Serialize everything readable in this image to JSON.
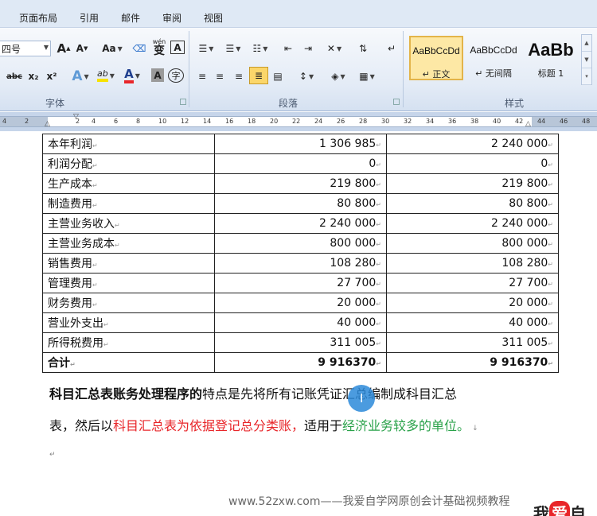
{
  "ribbon_tabs": [
    "页面布局",
    "引用",
    "邮件",
    "审阅",
    "视图"
  ],
  "font": {
    "size_value": "四号",
    "grow_label": "A",
    "shrink_label": "A",
    "case_label": "Aa",
    "phonetic_label": "wén",
    "border_char_label": "A",
    "strike_label": "abc",
    "sub_label": "x₂",
    "sup_label": "x²",
    "effect_label": "A",
    "highlight_label": "ab",
    "fontcolor_label": "A",
    "shading_label": "A",
    "enclose_label": "字",
    "group_label": "字体"
  },
  "paragraph": {
    "group_label": "段落"
  },
  "styles": {
    "group_label": "样式",
    "items": [
      {
        "preview": "AaBbCcDd",
        "name": "↵ 正文"
      },
      {
        "preview": "AaBbCcDd",
        "name": "↵ 无间隔"
      },
      {
        "preview": "AaBb",
        "name": "标题 1"
      }
    ]
  },
  "ruler": {
    "numbers": [
      "4",
      "2",
      "2",
      "4",
      "6",
      "8",
      "10",
      "12",
      "14",
      "16",
      "18",
      "20",
      "22",
      "24",
      "26",
      "28",
      "30",
      "32",
      "34",
      "36",
      "38",
      "40",
      "42",
      "44",
      "46",
      "48"
    ]
  },
  "table": {
    "rows": [
      [
        "本年利润",
        "1  306  985",
        "2  240  000"
      ],
      [
        "利润分配",
        "0",
        "0"
      ],
      [
        "生产成本",
        "219 800",
        "219  800"
      ],
      [
        "制造费用",
        "80 800",
        "80  800"
      ],
      [
        "主营业务收入",
        "2 240 000",
        "2  240  000"
      ],
      [
        "主营业务成本",
        "800 000",
        "800  000"
      ],
      [
        "销售费用",
        "108 280",
        "108  280"
      ],
      [
        "管理费用",
        "27 700",
        "27 700"
      ],
      [
        "财务费用",
        "20 000",
        "20  000"
      ],
      [
        "营业外支出",
        "40 000",
        "40  000"
      ],
      [
        "所得税费用",
        "311 005",
        "311  005"
      ]
    ],
    "total": [
      "合计",
      "9 916370",
      "9  916370"
    ]
  },
  "paragraph1": {
    "bold": "科目汇总表账务处理程序的",
    "rest": "特点是先将所有记账凭证汇总编制成科目汇总"
  },
  "paragraph2": {
    "start": "表，然后以",
    "red": "科目汇总表为依据登记总分类账，",
    "mid": "适用于",
    "green": "经济业务较多的单位。"
  },
  "watermark": "www.52zxw.com——我爱自学网原创会计基础视频教程",
  "logo": {
    "a": "我",
    "b": "爱",
    "c": "自"
  },
  "colors": {
    "red": "#e8262a",
    "green": "#2aa24a",
    "cursor": "#2b8ad9"
  }
}
